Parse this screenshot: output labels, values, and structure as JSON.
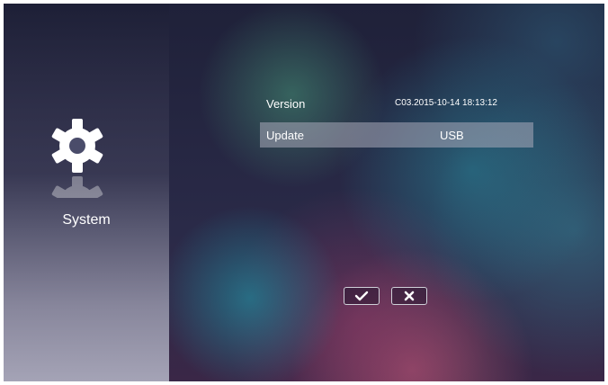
{
  "sidebar": {
    "label": "System",
    "icon": "gear-icon"
  },
  "rows": [
    {
      "label": "Version",
      "value": "C03.2015-10-14 18:13:12"
    },
    {
      "label": "Update",
      "value": "USB"
    }
  ],
  "buttons": {
    "confirm_icon": "check-icon",
    "cancel_icon": "close-icon"
  },
  "colors": {
    "highlight": "#aaaab9",
    "text": "#ffffff"
  }
}
